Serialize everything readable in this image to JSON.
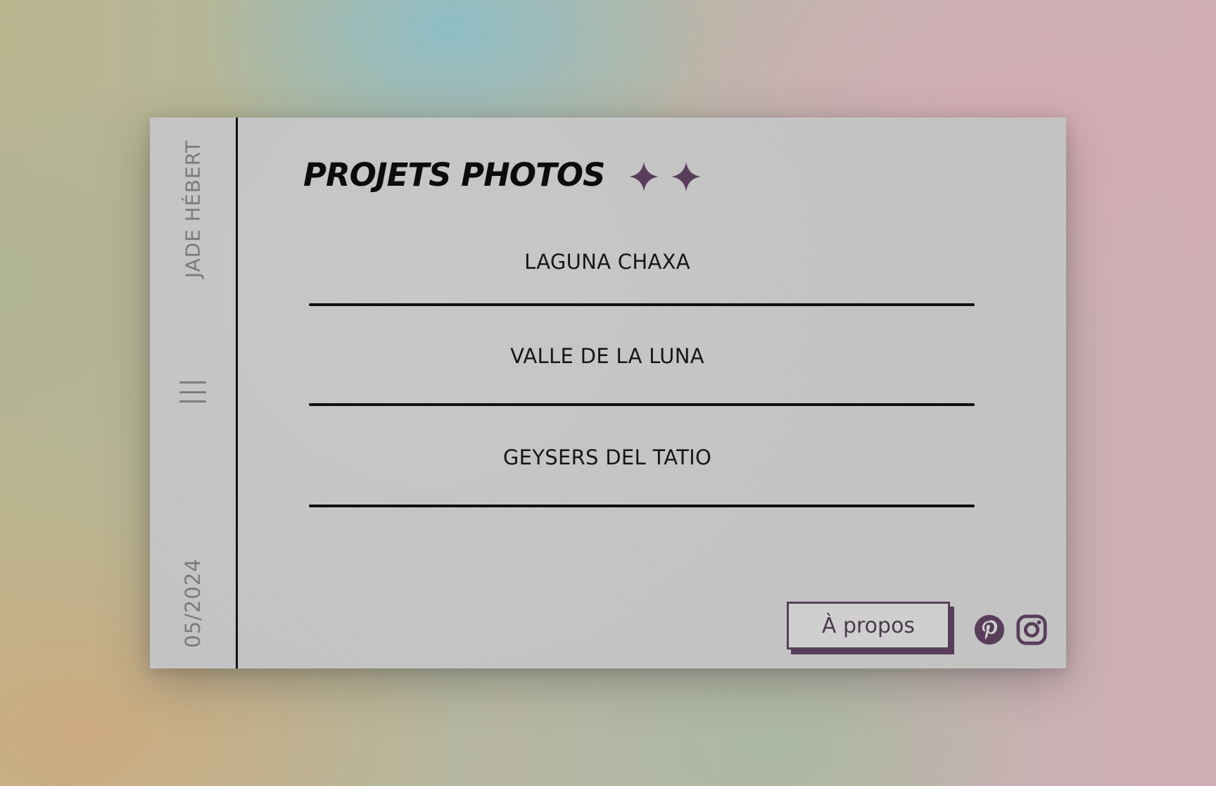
{
  "sidebar": {
    "author": "JADE HÉBERT",
    "date": "05/2024",
    "menu_icon": "hamburger-menu-icon"
  },
  "header": {
    "title": "PROJETS PHOTOS",
    "decoration_icon": "sparkle-icon"
  },
  "projects": [
    {
      "label": "LAGUNA CHAXA"
    },
    {
      "label": "VALLE DE LA LUNA"
    },
    {
      "label": "GEYSERS DEL TATIO"
    }
  ],
  "footer": {
    "about_label": "À propos",
    "social_icons": [
      "pinterest-icon",
      "instagram-icon"
    ]
  },
  "colors": {
    "accent": "#583e5a",
    "card": "#c4c4c4",
    "text": "#0c0c0c"
  }
}
